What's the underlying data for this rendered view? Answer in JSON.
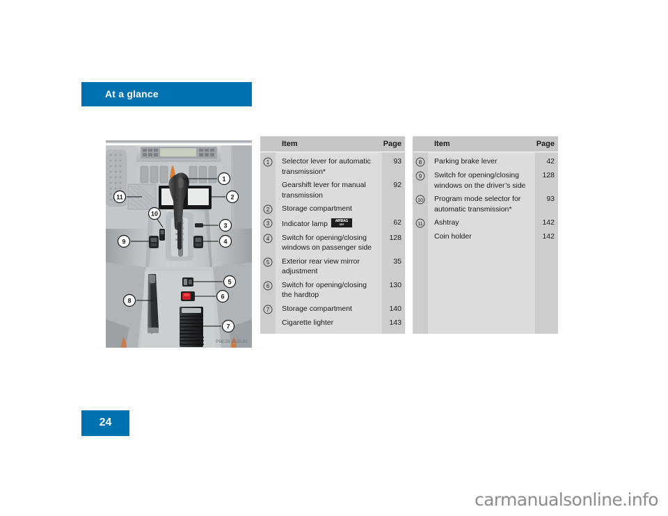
{
  "header": {
    "title": "At a glance"
  },
  "page_number": "24",
  "figure": {
    "code": "P68.20-2655-31",
    "alt_name": "center-console-photo",
    "callouts": [
      "1",
      "2",
      "3",
      "4",
      "5",
      "6",
      "7",
      "8",
      "9",
      "10",
      "11"
    ]
  },
  "tables": [
    {
      "headers": {
        "item": "Item",
        "page": "Page"
      },
      "rows": [
        {
          "marker": "1",
          "label": "Selector lever for automatic transmission*",
          "page": "93"
        },
        {
          "marker": "",
          "label": "Gearshift lever for manual transmission",
          "page": "92"
        },
        {
          "marker": "2",
          "label": "Storage compartment",
          "page": ""
        },
        {
          "marker": "3",
          "label": "Indicator lamp",
          "page": "62",
          "badge": {
            "top": "AIRBAG",
            "bottom": "OFF"
          }
        },
        {
          "marker": "4",
          "label": "Switch for opening/closing windows on passenger side",
          "page": "128"
        },
        {
          "marker": "5",
          "label": "Exterior rear view mirror adjustment",
          "page": "35"
        },
        {
          "marker": "6",
          "label": "Switch for opening/closing the hardtop",
          "page": "130"
        },
        {
          "marker": "7",
          "label": "Storage compartment",
          "page": "140"
        },
        {
          "marker": "",
          "label": "Cigarette lighter",
          "page": "143"
        }
      ]
    },
    {
      "headers": {
        "item": "Item",
        "page": "Page"
      },
      "rows": [
        {
          "marker": "8",
          "label": "Parking brake lever",
          "page": "42"
        },
        {
          "marker": "9",
          "label": "Switch for opening/closing windows on the driver’s side",
          "page": "128"
        },
        {
          "marker": "10",
          "label": "Program mode selector for automatic transmission*",
          "page": "93"
        },
        {
          "marker": "11",
          "label": "Ashtray",
          "page": "142"
        },
        {
          "marker": "",
          "label": "Coin holder",
          "page": "142"
        }
      ]
    }
  ],
  "watermark": "carmanualsonline.info",
  "colors": {
    "accent_blue": "#0072b0",
    "table_bg": "#dcdcdc",
    "table_gutter": "#cdcdcd",
    "table_header": "#c6c6c6"
  }
}
